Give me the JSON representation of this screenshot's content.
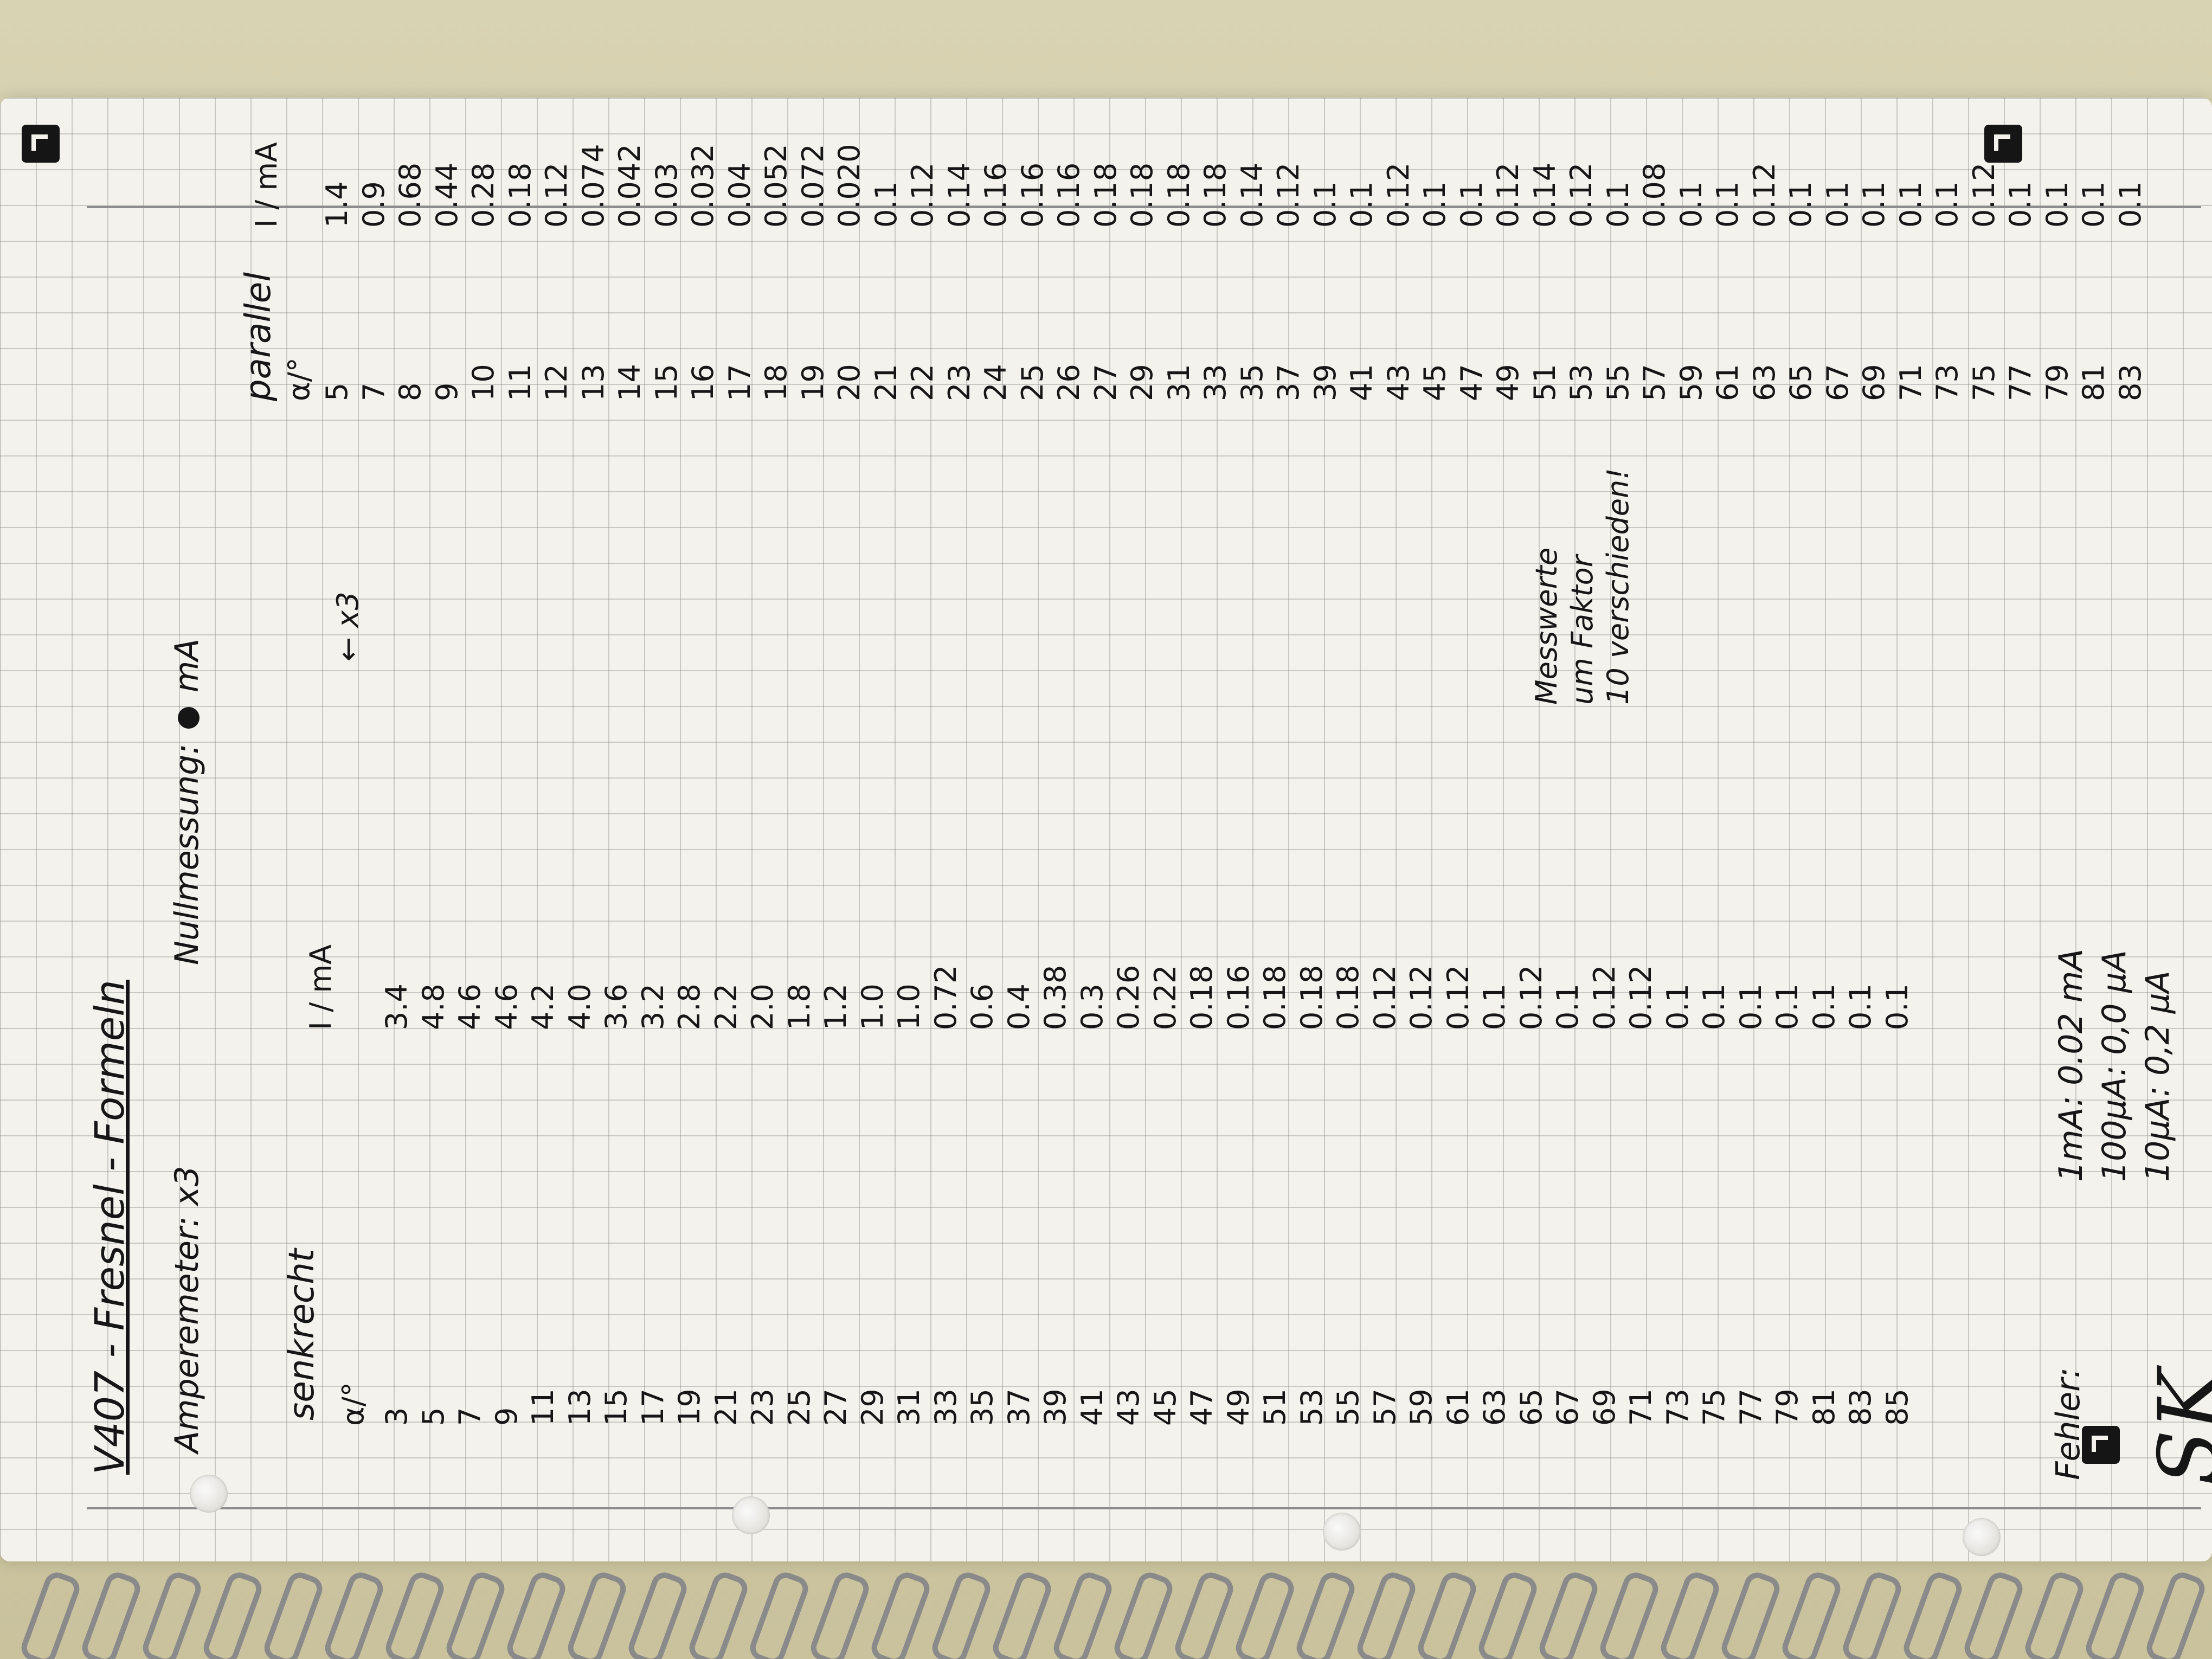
{
  "title": "V407 - Fresnel - Formeln",
  "amperemeter": "Amperemeter: x3",
  "nullmessung": "Nullmessung:",
  "nullmessung_unit": "mA",
  "senkrecht": {
    "label": "senkrecht",
    "angle_header": "α/°",
    "current_header": "I / mA",
    "rows": [
      {
        "angle": "3",
        "current": "3.4"
      },
      {
        "angle": "5",
        "current": "4.8"
      },
      {
        "angle": "7",
        "current": "4.6"
      },
      {
        "angle": "9",
        "current": "4.6"
      },
      {
        "angle": "11",
        "current": "4.2"
      },
      {
        "angle": "13",
        "current": "4.0"
      },
      {
        "angle": "15",
        "current": "3.6"
      },
      {
        "angle": "17",
        "current": "3.2"
      },
      {
        "angle": "19",
        "current": "2.8"
      },
      {
        "angle": "21",
        "current": "2.2"
      },
      {
        "angle": "23",
        "current": "2.0"
      },
      {
        "angle": "25",
        "current": "1.8"
      },
      {
        "angle": "27",
        "current": "1.2"
      },
      {
        "angle": "29",
        "current": "1.0"
      },
      {
        "angle": "31",
        "current": "1.0"
      },
      {
        "angle": "33",
        "current": "0.72"
      },
      {
        "angle": "35",
        "current": "0.6"
      },
      {
        "angle": "37",
        "current": "0.4"
      },
      {
        "angle": "39",
        "current": "0.38"
      },
      {
        "angle": "41",
        "current": "0.3"
      },
      {
        "angle": "43",
        "current": "0.26"
      },
      {
        "angle": "45",
        "current": "0.22"
      },
      {
        "angle": "47",
        "current": "0.18"
      },
      {
        "angle": "49",
        "current": "0.16"
      },
      {
        "angle": "51",
        "current": "0.18"
      },
      {
        "angle": "53",
        "current": "0.18"
      },
      {
        "angle": "55",
        "current": "0.18"
      },
      {
        "angle": "57",
        "current": "0.12"
      },
      {
        "angle": "59",
        "current": "0.12"
      },
      {
        "angle": "61",
        "current": "0.12"
      },
      {
        "angle": "63",
        "current": "0.1"
      },
      {
        "angle": "65",
        "current": "0.12"
      },
      {
        "angle": "67",
        "current": "0.1"
      },
      {
        "angle": "69",
        "current": "0.12"
      },
      {
        "angle": "71",
        "current": "0.12"
      },
      {
        "angle": "73",
        "current": "0.1"
      },
      {
        "angle": "75",
        "current": "0.1"
      },
      {
        "angle": "77",
        "current": "0.1"
      },
      {
        "angle": "79",
        "current": "0.1"
      },
      {
        "angle": "81",
        "current": "0.1"
      },
      {
        "angle": "83",
        "current": "0.1"
      },
      {
        "angle": "85",
        "current": "0.1"
      }
    ]
  },
  "parallel": {
    "label": "parallel",
    "angle_header": "α/°",
    "current_header": "I / mA",
    "rows": [
      {
        "angle": "5",
        "current": "1.4"
      },
      {
        "angle": "7",
        "current": "0.9"
      },
      {
        "angle": "8",
        "current": "0.68"
      },
      {
        "angle": "9",
        "current": "0.44"
      },
      {
        "angle": "10",
        "current": "0.28"
      },
      {
        "angle": "11",
        "current": "0.18"
      },
      {
        "angle": "12",
        "current": "0.12"
      },
      {
        "angle": "13",
        "current": "0.074"
      },
      {
        "angle": "14",
        "current": "0.042"
      },
      {
        "angle": "15",
        "current": "0.03"
      },
      {
        "angle": "16",
        "current": "0.032"
      },
      {
        "angle": "17",
        "current": "0.04"
      },
      {
        "angle": "18",
        "current": "0.052"
      },
      {
        "angle": "19",
        "current": "0.072"
      },
      {
        "angle": "20",
        "current": "0.020"
      },
      {
        "angle": "21",
        "current": "0.1"
      },
      {
        "angle": "22",
        "current": "0.12"
      },
      {
        "angle": "23",
        "current": "0.14"
      },
      {
        "angle": "24",
        "current": "0.16"
      },
      {
        "angle": "25",
        "current": "0.16"
      },
      {
        "angle": "26",
        "current": "0.16"
      },
      {
        "angle": "27",
        "current": "0.18"
      },
      {
        "angle": "29",
        "current": "0.18"
      },
      {
        "angle": "31",
        "current": "0.18"
      },
      {
        "angle": "33",
        "current": "0.18"
      },
      {
        "angle": "35",
        "current": "0.14"
      },
      {
        "angle": "37",
        "current": "0.12"
      },
      {
        "angle": "39",
        "current": "0.1"
      },
      {
        "angle": "41",
        "current": "0.1"
      },
      {
        "angle": "43",
        "current": "0.12"
      },
      {
        "angle": "45",
        "current": "0.1"
      },
      {
        "angle": "47",
        "current": "0.1"
      },
      {
        "angle": "49",
        "current": "0.12"
      },
      {
        "angle": "51",
        "current": "0.14"
      },
      {
        "angle": "53",
        "current": "0.12"
      },
      {
        "angle": "55",
        "current": "0.1"
      },
      {
        "angle": "57",
        "current": "0.08"
      },
      {
        "angle": "59",
        "current": "0.1"
      },
      {
        "angle": "61",
        "current": "0.1"
      },
      {
        "angle": "63",
        "current": "0.12"
      },
      {
        "angle": "65",
        "current": "0.1"
      },
      {
        "angle": "67",
        "current": "0.1"
      },
      {
        "angle": "69",
        "current": "0.1"
      },
      {
        "angle": "71",
        "current": "0.1"
      },
      {
        "angle": "73",
        "current": "0.1"
      },
      {
        "angle": "75",
        "current": "0.12"
      },
      {
        "angle": "77",
        "current": "0.1"
      },
      {
        "angle": "79",
        "current": "0.1"
      },
      {
        "angle": "81",
        "current": "0.1"
      },
      {
        "angle": "83",
        "current": "0.1"
      }
    ]
  },
  "x3_note": "← x3",
  "measure_note": [
    "Messwerte",
    "um Faktor",
    "10 verschieden!"
  ],
  "fehler": {
    "title": "Fehler:",
    "items": [
      "1mA: 0.02 mA",
      "100μA: 0,0 μA",
      "10μA: 0,2 μA"
    ]
  },
  "signature": "SK"
}
